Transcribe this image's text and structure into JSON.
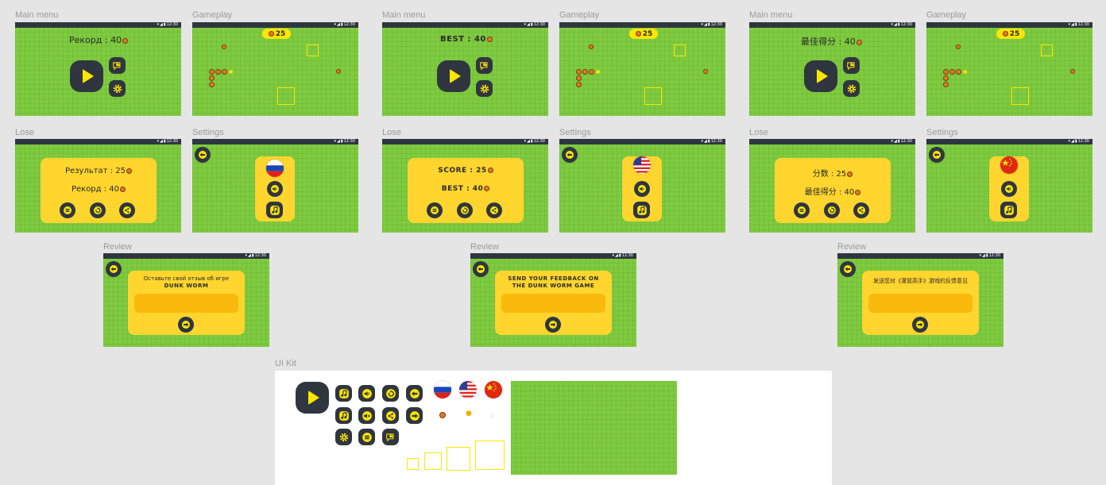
{
  "status_time": "12:30",
  "labels": {
    "main_menu": "Main menu",
    "gameplay": "Gameplay",
    "lose": "Lose",
    "settings": "Settings",
    "review": "Review",
    "ui_kit": "UI Kit"
  },
  "game": {
    "score": "25"
  },
  "ru": {
    "record": "Рекорд : 40",
    "result": "Результат : 25",
    "review_line1": "Оставьте свой отзыв об игре",
    "review_line2": "DUNK WORM"
  },
  "en": {
    "best": "BEST : 40",
    "score": "SCORE : 25",
    "review_line1": "SEND YOUR FEEDBACK ON",
    "review_line2": "THE DUNK WORM GAME"
  },
  "zh": {
    "best": "最佳得分 : 40",
    "score": "分数 : 25",
    "review_line1": "发送您对《灌篮高手》游戏的反馈意见"
  },
  "colors": {
    "field_green": "#7ecb3f",
    "button_dark": "#2f3640",
    "accent_yellow": "#ffe600",
    "card_yellow": "#ffd52e",
    "ball_orange": "#e07b25"
  }
}
